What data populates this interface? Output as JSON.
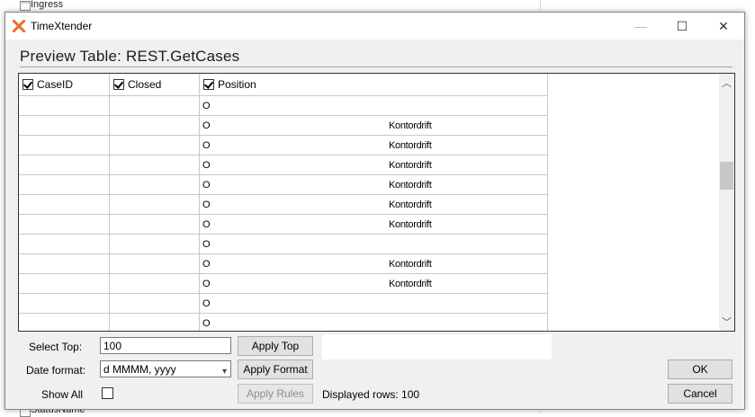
{
  "background": {
    "tree_top_label": "Ingress",
    "tree_bottom_label": "StatusName"
  },
  "window": {
    "app_title": "TimeXtender",
    "minimize_glyph": "—",
    "maximize_glyph": "☐",
    "close_glyph": "✕"
  },
  "heading": "Preview Table: REST.GetCases",
  "grid": {
    "columns": [
      "CaseID",
      "Closed",
      "Position"
    ],
    "rows": [
      {
        "lead": "O",
        "text": ""
      },
      {
        "lead": "O",
        "text": "Kontordrift"
      },
      {
        "lead": "O",
        "text": "Kontordrift"
      },
      {
        "lead": "O",
        "text": "Kontordrift"
      },
      {
        "lead": "O",
        "text": "Kontordrift"
      },
      {
        "lead": "O",
        "text": "Kontordrift"
      },
      {
        "lead": "O",
        "text": "Kontordrift"
      },
      {
        "lead": "O",
        "text": ""
      },
      {
        "lead": "O",
        "text": "Kontordrift"
      },
      {
        "lead": "O",
        "text": "Kontordrift"
      },
      {
        "lead": "O",
        "text": ""
      },
      {
        "lead": "O",
        "text": ""
      }
    ],
    "scroll_up_glyph": "︿",
    "scroll_down_glyph": "﹀"
  },
  "controls": {
    "select_top_label": "Select Top:",
    "select_top_value": "100",
    "apply_top": "Apply Top",
    "date_format_label": "Date format:",
    "date_format_value": "d MMMM, yyyy",
    "apply_format": "Apply Format",
    "show_all_label": "Show All",
    "apply_rules": "Apply Rules",
    "displayed_rows": "Displayed rows: 100",
    "ok": "OK",
    "cancel": "Cancel"
  },
  "colors": {
    "app_icon": "#e8702a"
  }
}
